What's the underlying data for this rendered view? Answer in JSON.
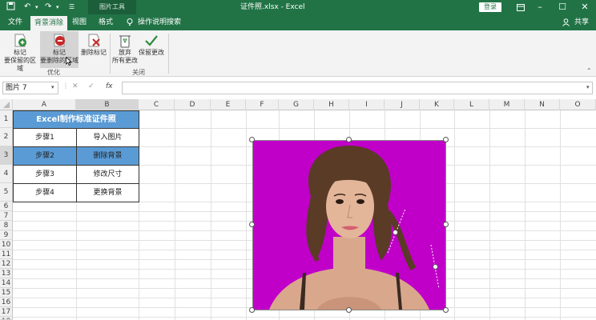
{
  "titlebar": {
    "context_tool": "图片工具",
    "title": "证件照.xlsx - Excel",
    "login": "登录"
  },
  "tabs": [
    {
      "label": "文件"
    },
    {
      "label": "背景消除"
    },
    {
      "label": "视图"
    },
    {
      "label": "格式"
    },
    {
      "label": "操作说明搜索"
    }
  ],
  "share_label": "共享",
  "ribbon": {
    "mark_keep": {
      "line1": "标记",
      "line2": "要保留的区域"
    },
    "mark_remove": {
      "line1": "标记",
      "line2": "要删除的区域"
    },
    "delete_mark": {
      "line1": "删除标记"
    },
    "group_optimize": "优化",
    "discard": {
      "line1": "放弃",
      "line2": "所有更改"
    },
    "keep_changes": {
      "line1": "保留更改"
    },
    "group_close": "关闭"
  },
  "formula_bar": {
    "name_box": "图片 7",
    "fx": "fx"
  },
  "columns": [
    "A",
    "B",
    "C",
    "D",
    "E",
    "F",
    "G",
    "H",
    "I",
    "J",
    "K",
    "L",
    "M",
    "N",
    "O"
  ],
  "rows": [
    "1",
    "2",
    "3",
    "4",
    "5",
    "6",
    "7",
    "8",
    "9",
    "10",
    "11",
    "12",
    "13",
    "14",
    "15",
    "16",
    "17",
    "18"
  ],
  "table": {
    "header": "Excel制作标准证件照",
    "steps": [
      {
        "step": "步骤1",
        "action": "导入图片"
      },
      {
        "step": "步骤2",
        "action": "删除背景"
      },
      {
        "step": "步骤3",
        "action": "修改尺寸"
      },
      {
        "step": "步骤4",
        "action": "更换背景"
      }
    ]
  },
  "colors": {
    "brand": "#217346",
    "header_fill": "#5b9bd5",
    "photo_bg": "#c000c8"
  }
}
